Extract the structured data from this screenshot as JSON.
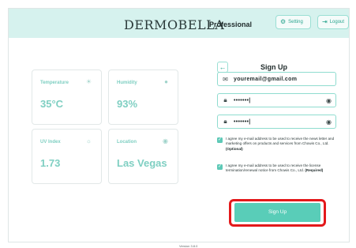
{
  "header": {
    "brand": "DERMOBELLA",
    "brand_sub": "Professional",
    "setting_label": "Setting",
    "logout_label": "Logout"
  },
  "weather": {
    "cards": [
      {
        "label": "Temperature",
        "value": "35°C",
        "icon": "sun-icon"
      },
      {
        "label": "Humidity",
        "value": "93%",
        "icon": "droplet-icon"
      },
      {
        "label": "UV Index",
        "value": "1.73",
        "icon": "uv-icon"
      },
      {
        "label": "Location",
        "value": "Las Vegas",
        "icon": "location-icon"
      }
    ]
  },
  "signup": {
    "title": "Sign Up",
    "email": "youremail@gmail.com",
    "password": "•••••••|",
    "confirm_password": "•••••••|",
    "agree1_text": "I agree my e-mail address to be used to receive the news letter and marketing offers on products and services from Chowis Co., Ltd.",
    "agree1_tag": "(Optional)",
    "agree2_text": "I agree my e-mail address to be used to receive the license termination/renewal notice from Chowis Co., Ltd.",
    "agree2_tag": "(Required)",
    "button_label": "Sign Up"
  },
  "footer": {
    "version": "Version 3.8.0"
  },
  "colors": {
    "accent": "#59cdb8",
    "header_bg": "#d6f2ee",
    "highlight": "#e3191b"
  }
}
